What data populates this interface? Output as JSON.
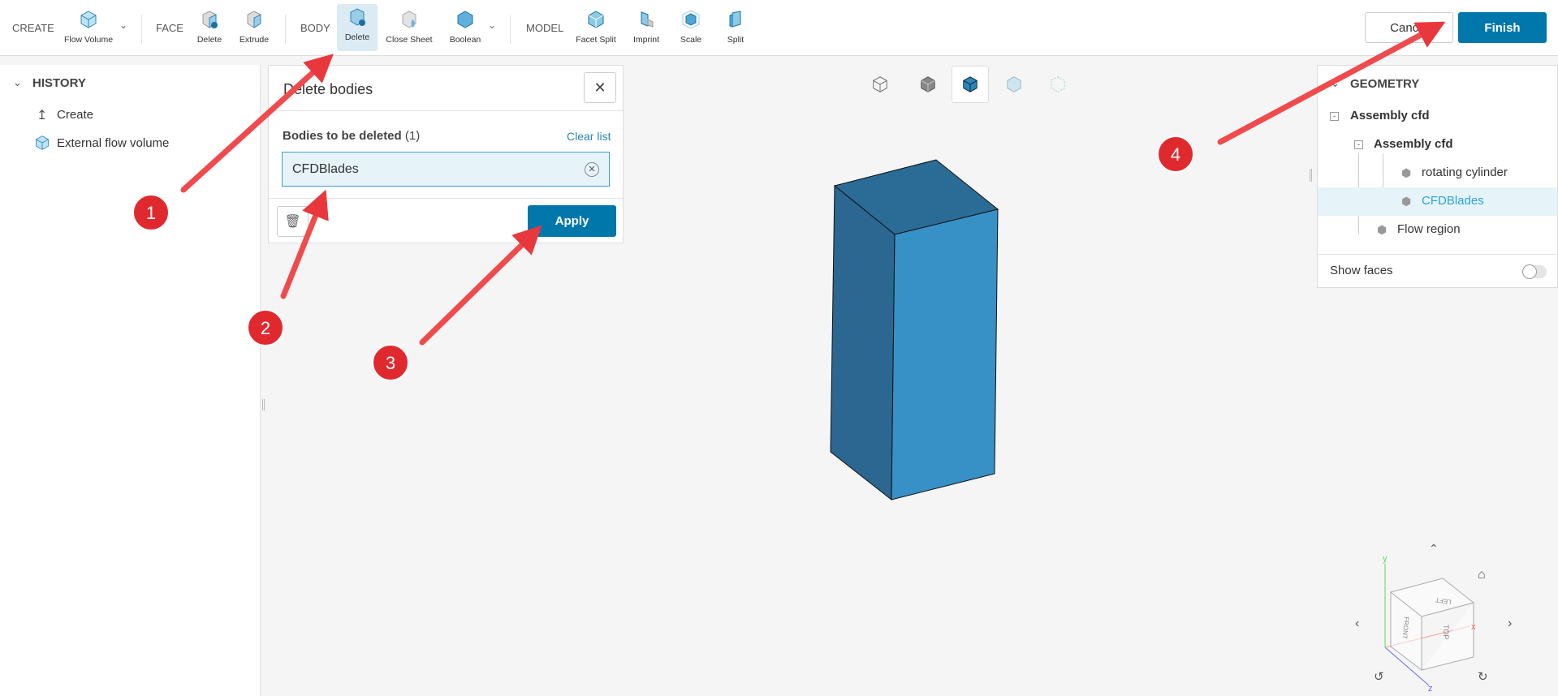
{
  "toolbar": {
    "groups": {
      "create": "CREATE",
      "face": "FACE",
      "body": "BODY",
      "model": "MODEL"
    },
    "tools": {
      "flow_volume": "Flow Volume",
      "face_delete": "Delete",
      "extrude": "Extrude",
      "body_delete": "Delete",
      "close_sheet": "Close Sheet",
      "boolean": "Boolean",
      "facet_split": "Facet Split",
      "imprint": "Imprint",
      "scale": "Scale",
      "split": "Split"
    },
    "cancel": "Cancel",
    "finish": "Finish"
  },
  "history": {
    "title": "HISTORY",
    "items": [
      "Create",
      "External flow volume"
    ]
  },
  "dialog": {
    "title": "Delete bodies",
    "field_label": "Bodies to be deleted",
    "count": "(1)",
    "clear": "Clear list",
    "value": "CFDBlades",
    "apply": "Apply"
  },
  "geometry": {
    "title": "GEOMETRY",
    "tree": [
      "Assembly cfd",
      "Assembly cfd",
      "rotating cylinder",
      "CFDBlades",
      "Flow region"
    ],
    "show_faces": "Show faces",
    "show_faces_on": false
  },
  "gizmo": {
    "axes": [
      "x",
      "y",
      "z"
    ],
    "faces": [
      "LEFT",
      "FRONT",
      "TOP"
    ]
  },
  "annotations": [
    "1",
    "2",
    "3",
    "4"
  ],
  "colors": {
    "accent": "#0077aa",
    "selected": "#29a3d9",
    "annotation": "#e8383d",
    "box_top": "#2a6c96",
    "box_left": "#2b6791",
    "box_right": "#3790c6"
  }
}
